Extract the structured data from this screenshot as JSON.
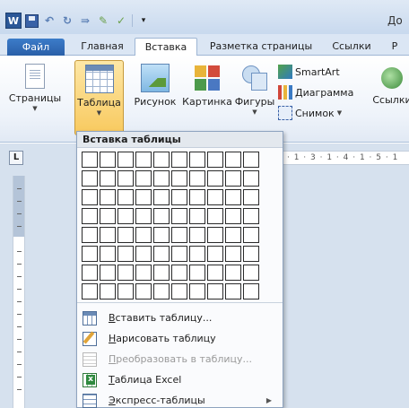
{
  "window": {
    "title_fragment": "До"
  },
  "tabs": [
    {
      "label": "Файл"
    },
    {
      "label": "Главная"
    },
    {
      "label": "Вставка"
    },
    {
      "label": "Разметка страницы"
    },
    {
      "label": "Ссылки"
    },
    {
      "label": "Р"
    }
  ],
  "ribbon": {
    "pages": "Страницы",
    "table": "Таблица",
    "picture": "Рисунок",
    "clipart": "Картинка",
    "shapes": "Фигуры",
    "smartart": "SmartArt",
    "chart": "Диаграмма",
    "screenshot": "Снимок",
    "links": "Ссылки"
  },
  "ruler": {
    "marks": "· 1 · 3 · 1 · 4 · 1 · 5 · 1"
  },
  "dropdown": {
    "header": "Вставка таблицы",
    "grid_cols": 10,
    "grid_rows": 8,
    "items": [
      {
        "label": "Вставить таблицу...",
        "accel": "В",
        "enabled": true
      },
      {
        "label": "Нарисовать таблицу",
        "accel": "Н",
        "enabled": true
      },
      {
        "label": "Преобразовать в таблицу...",
        "accel": "П",
        "enabled": false
      },
      {
        "label": "Таблица Excel",
        "accel": "Т",
        "enabled": true
      },
      {
        "label": "Экспресс-таблицы",
        "accel": "Э",
        "enabled": true,
        "submenu": true
      }
    ]
  },
  "colors": {
    "accent": "#2a5fa8",
    "active_button": "#f8c95e"
  }
}
